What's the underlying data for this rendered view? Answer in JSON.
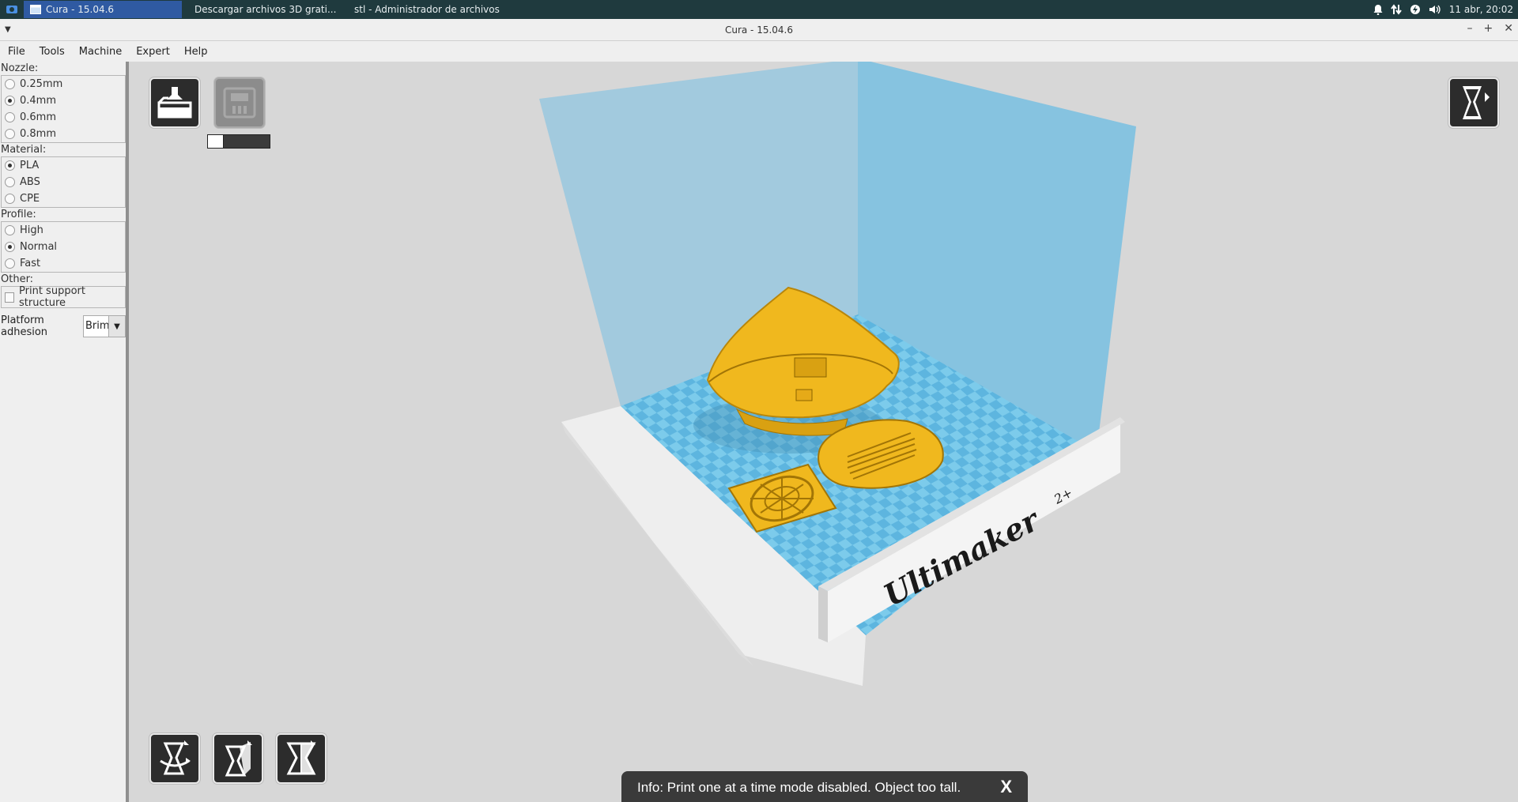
{
  "taskbar": {
    "tasks": [
      {
        "label": "Cura - 15.04.6",
        "active": true
      },
      {
        "label": "Descargar archivos 3D grati...",
        "active": false
      },
      {
        "label": "stl - Administrador de archivos",
        "active": false
      }
    ],
    "clock": "11 abr, 20:02"
  },
  "window": {
    "title": "Cura - 15.04.6"
  },
  "menubar": {
    "items": [
      "File",
      "Tools",
      "Machine",
      "Expert",
      "Help"
    ]
  },
  "settings": {
    "nozzle": {
      "label": "Nozzle:",
      "options": [
        "0.25mm",
        "0.4mm",
        "0.6mm",
        "0.8mm"
      ],
      "selected": "0.4mm"
    },
    "material": {
      "label": "Material:",
      "options": [
        "PLA",
        "ABS",
        "CPE"
      ],
      "selected": "PLA"
    },
    "profile": {
      "label": "Profile:",
      "options": [
        "High",
        "Normal",
        "Fast"
      ],
      "selected": "Normal"
    },
    "other": {
      "label": "Other:",
      "support_label": "Print support structure",
      "support_checked": false
    },
    "adhesion": {
      "label": "Platform adhesion",
      "value": "Brim"
    }
  },
  "viewport": {
    "progress": 0.25,
    "brand_text": "Ultimaker",
    "brand_sup": "2+"
  },
  "colors": {
    "model": "#f0b81e",
    "bed_blue": "#6fc3e6",
    "wall_blue": "#87c7e4",
    "taskbar": "#1f3a3e",
    "active_task": "#2f5aa2"
  },
  "toast": {
    "message": "Info: Print one at a time mode disabled. Object too tall.",
    "close_label": "X"
  }
}
